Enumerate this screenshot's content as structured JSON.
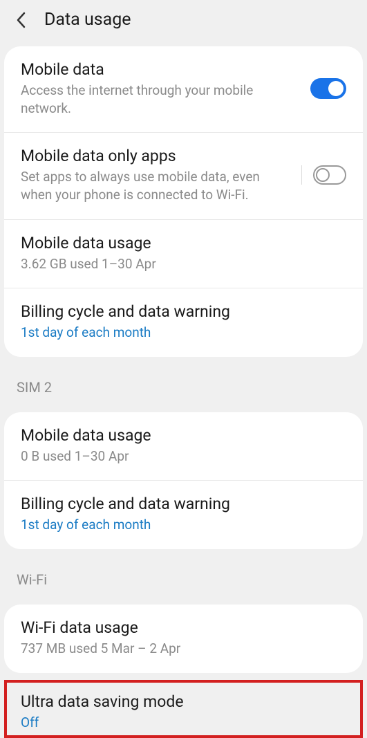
{
  "header": {
    "title": "Data usage"
  },
  "card1": {
    "mobileData": {
      "title": "Mobile data",
      "sub": "Access the internet through your mobile network."
    },
    "mobileDataOnlyApps": {
      "title": "Mobile data only apps",
      "sub": "Set apps to always use mobile data, even when your phone is connected to Wi-Fi."
    },
    "mobileDataUsage": {
      "title": "Mobile data usage",
      "sub": "3.62 GB used 1–30 Apr"
    },
    "billingCycle": {
      "title": "Billing cycle and data warning",
      "sub": "1st day of each month"
    }
  },
  "section2": {
    "header": "SIM 2",
    "mobileDataUsage": {
      "title": "Mobile data usage",
      "sub": "0 B used 1–30 Apr"
    },
    "billingCycle": {
      "title": "Billing cycle and data warning",
      "sub": "1st day of each month"
    }
  },
  "section3": {
    "header": "Wi-Fi",
    "wifiDataUsage": {
      "title": "Wi-Fi data usage",
      "sub": "737 MB used 5 Mar – 2 Apr"
    }
  },
  "ultraDataSaving": {
    "title": "Ultra data saving mode",
    "sub": "Off"
  }
}
